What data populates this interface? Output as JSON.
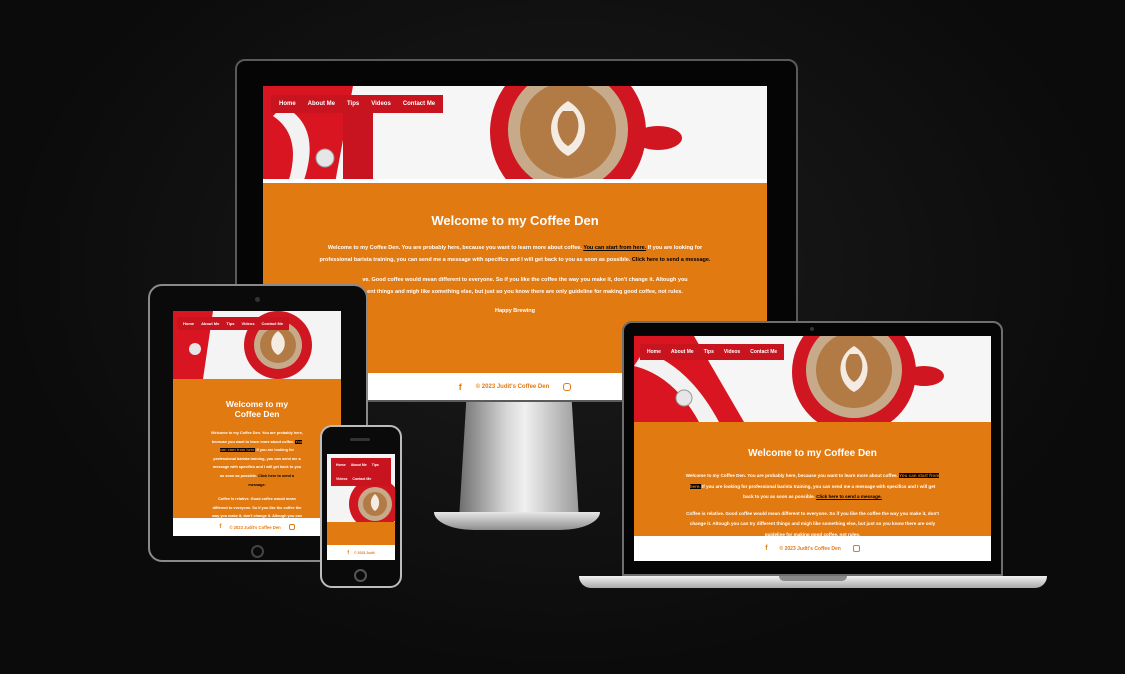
{
  "site": {
    "nav": [
      "Home",
      "About Me",
      "Tips",
      "Videos",
      "Contact Me"
    ],
    "heading": "Welcome to my Coffee Den",
    "intro": {
      "before_link": "Welcome to my Coffee Den. You are probably here, because you want to learn more about coffee.",
      "link_start": "You can start from here.",
      "middle": "If you are looking for professional barista training, you can send me a message with specifics and I will get back to you as soon as possible.",
      "link_message": "Click here to send a message."
    },
    "relative": "Coffee is relative. Good coffee would mean different to everyone. So if you like the coffee the way you make it, don't change it. Altough you can try different things and migh like something else, but just so you know there are only guideline for making good coffee, not rules.",
    "relative_visible_imac": "ve. Good coffee would mean different to everyone. So if you like the coffee the way you make it, don't change it. Altough you",
    "relative_visible_imac2": "ent things and migh like something else, but just so you know there are only guideline for making good coffee, not rules.",
    "sign_off": "Happy Brewing",
    "footer": "© 2023 Judit's Coffee Den",
    "footer_phone": "© 2023 Judit",
    "footer_tablet": "© 2023 Judit's Coffee Den",
    "icons": {
      "left": "facebook-icon",
      "right": "instagram-icon"
    }
  },
  "colors": {
    "accent": "#e27a12",
    "nav": "#c8141e",
    "footer_bg": "#ffffff",
    "page_bg": "#0b0b0b"
  }
}
